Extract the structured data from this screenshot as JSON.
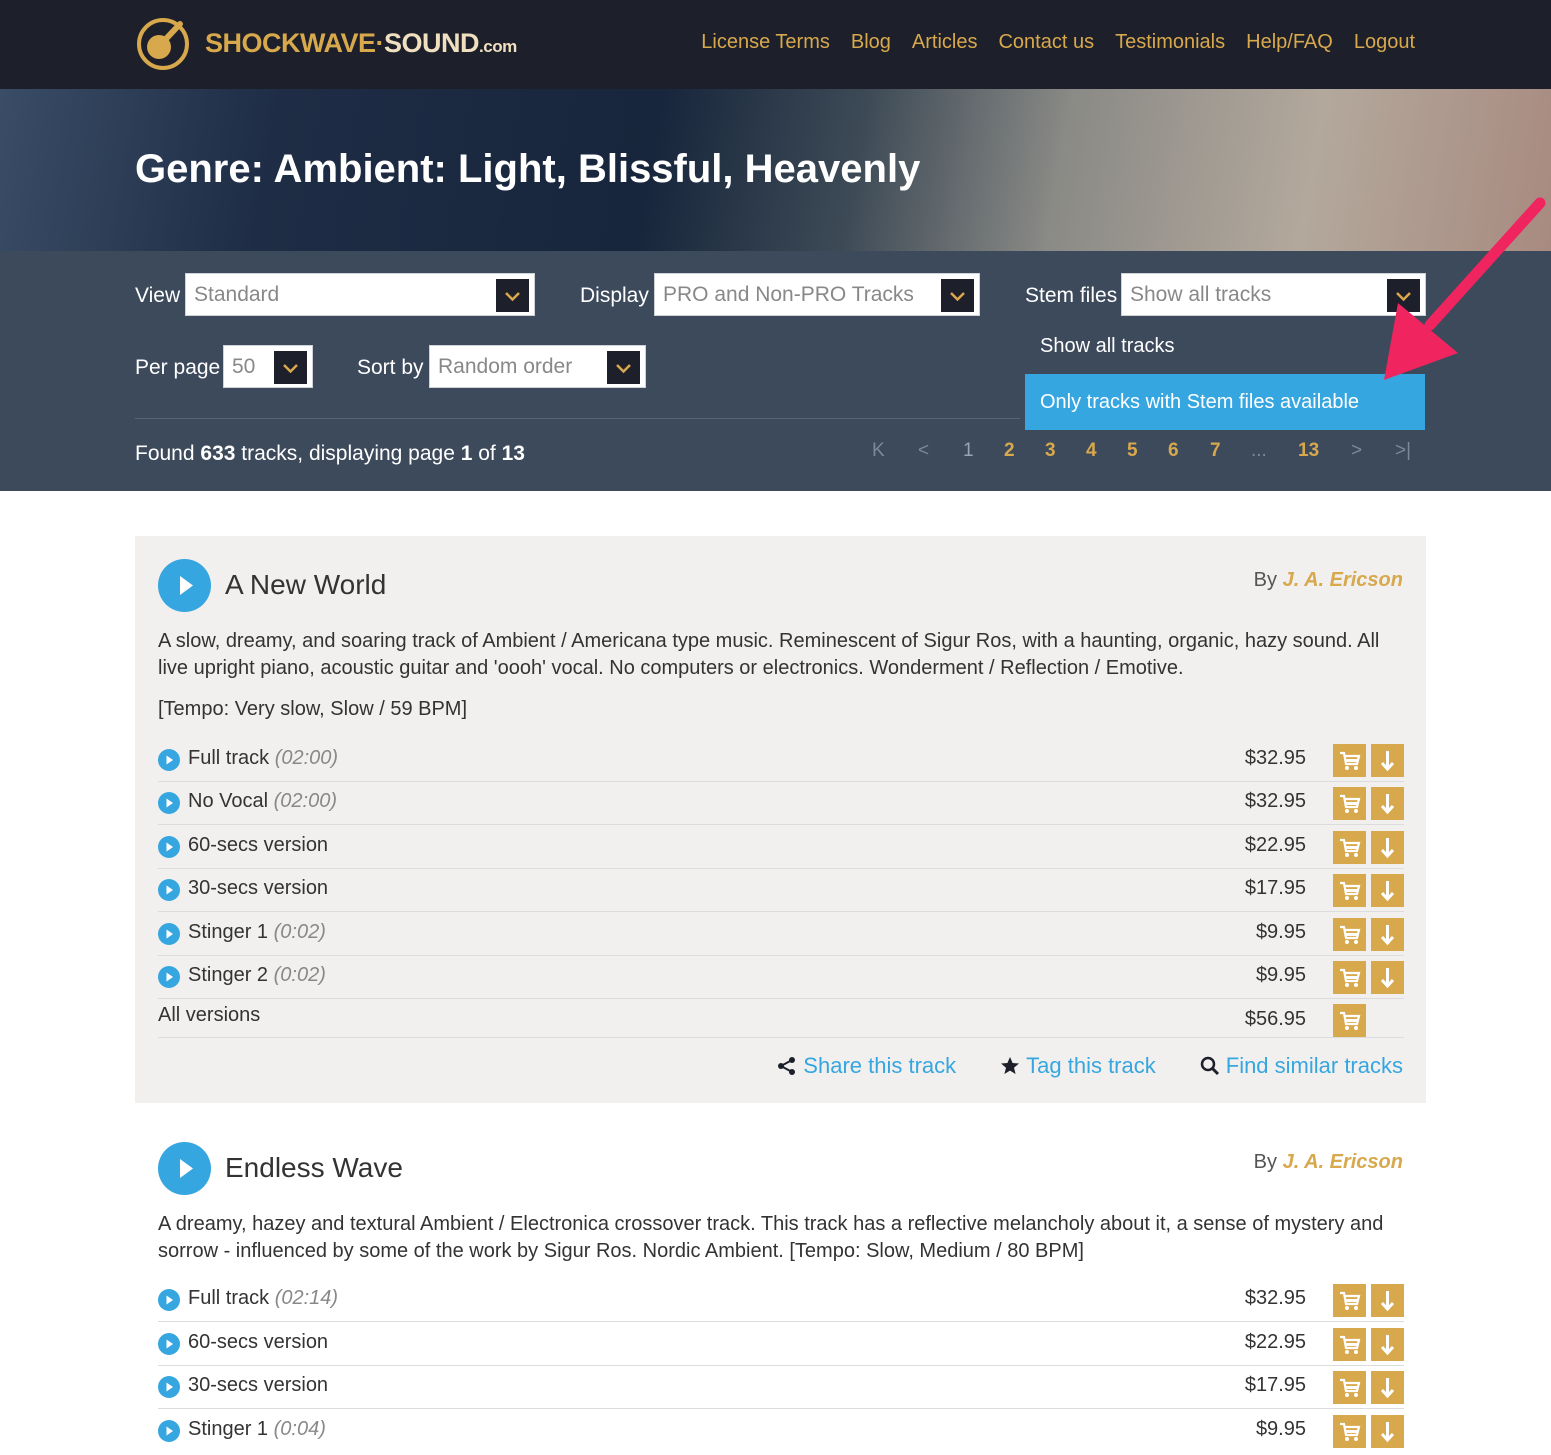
{
  "header": {
    "brand": {
      "part1": "SHOCKWAVE",
      "dot": "·",
      "part2": "SOUND",
      "suffix": ".com"
    },
    "nav": [
      "License Terms",
      "Blog",
      "Articles",
      "Contact us",
      "Testimonials",
      "Help/FAQ",
      "Logout"
    ]
  },
  "hero": {
    "title": "Genre: Ambient: Light, Blissful, Heavenly"
  },
  "filters": {
    "view": {
      "label": "View",
      "value": "Standard"
    },
    "display": {
      "label": "Display",
      "value": "PRO and Non-PRO Tracks"
    },
    "stem": {
      "label": "Stem files",
      "value": "Show all tracks",
      "options": [
        "Show all tracks",
        "Only tracks with Stem files available"
      ]
    },
    "per_page": {
      "label": "Per page",
      "value": "50"
    },
    "sort_by": {
      "label": "Sort by",
      "value": "Random order"
    }
  },
  "results": {
    "found_prefix": "Found ",
    "count": "633",
    "middle": " tracks, displaying page ",
    "page": "1",
    "of": " of ",
    "total_pages": "13"
  },
  "pagination": {
    "first": "K",
    "prev": "<",
    "pages": [
      "1",
      "2",
      "3",
      "4",
      "5",
      "6",
      "7"
    ],
    "ellipsis": "...",
    "last_page": "13",
    "next": ">",
    "last": ">|"
  },
  "tracks": [
    {
      "title": "A New World",
      "by_label": "By ",
      "author": "J. A. Ericson",
      "description": "A slow, dreamy, and soaring track of Ambient / Americana type music. Reminescent of Sigur Ros, with a haunting, organic, hazy sound. All live upright piano, acoustic guitar and 'oooh' vocal. No computers or electronics. Wonderment / Reflection / Emotive.",
      "tempo": "[Tempo: Very slow, Slow / 59 BPM]",
      "versions": [
        {
          "name": "Full track",
          "duration": "(02:00)",
          "price": "$32.95"
        },
        {
          "name": "No Vocal",
          "duration": "(02:00)",
          "price": "$32.95"
        },
        {
          "name": "60-secs version",
          "duration": "",
          "price": "$22.95"
        },
        {
          "name": "30-secs version",
          "duration": "",
          "price": "$17.95"
        },
        {
          "name": "Stinger 1",
          "duration": "(0:02)",
          "price": "$9.95"
        },
        {
          "name": "Stinger 2",
          "duration": "(0:02)",
          "price": "$9.95"
        }
      ],
      "all_versions": {
        "label": "All versions",
        "price": "$56.95"
      },
      "actions": {
        "share": "Share this track",
        "tag": "Tag this track",
        "similar": "Find similar tracks"
      }
    },
    {
      "title": "Endless Wave",
      "by_label": "By ",
      "author": "J. A. Ericson",
      "description": "A dreamy, hazey and textural Ambient / Electronica crossover track. This track has a reflective melancholy about it, a sense of mystery and sorrow - influenced by some of the work by Sigur Ros. Nordic Ambient. [Tempo: Slow, Medium / 80 BPM]",
      "versions": [
        {
          "name": "Full track",
          "duration": "(02:14)",
          "price": "$32.95"
        },
        {
          "name": "60-secs version",
          "duration": "",
          "price": "$22.95"
        },
        {
          "name": "30-secs version",
          "duration": "",
          "price": "$17.95"
        },
        {
          "name": "Stinger 1",
          "duration": "(0:04)",
          "price": "$9.95"
        }
      ]
    }
  ],
  "colors": {
    "header_bg": "#1d1f2a",
    "gold": "#d8a84c",
    "filter_panel": "#3c4a5c",
    "accent_blue": "#36a6e0",
    "arrow": "#f0245e",
    "card_bg": "#f1f0ee"
  }
}
